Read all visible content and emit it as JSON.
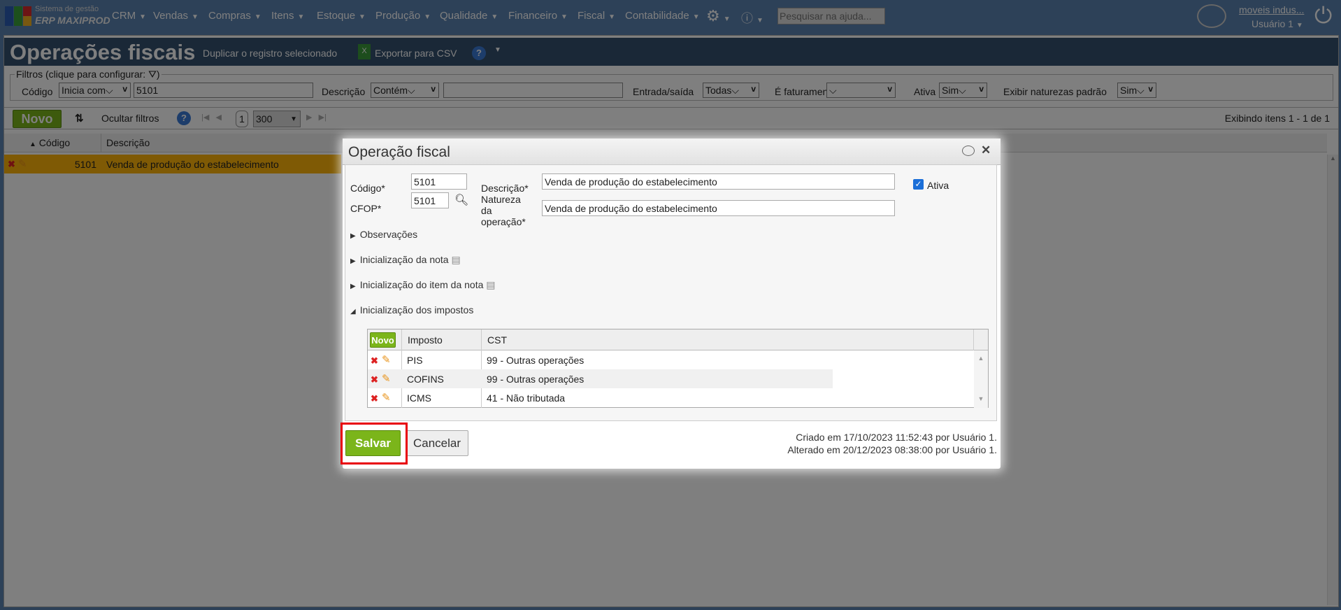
{
  "app": {
    "brand_line1": "Sistema de gestão",
    "brand_line2": "ERP MAXIPROD",
    "menu": [
      "CRM",
      "Vendas",
      "Compras",
      "Itens",
      "Estoque",
      "Produção",
      "Qualidade",
      "Financeiro",
      "Fiscal",
      "Contabilidade"
    ],
    "help_search_placeholder": "Pesquisar na ajuda...",
    "company": "moveis indus...",
    "user": "Usuário 1"
  },
  "page": {
    "title": "Operações fiscais",
    "duplicate": "Duplicar o registro selecionado",
    "export": "Exportar para CSV"
  },
  "filters": {
    "legend": "Filtros (clique para configurar:",
    "legend_end": ")",
    "codigo_label": "Código",
    "codigo_op": "Inicia com",
    "codigo_value": "5101",
    "descricao_label": "Descrição",
    "descricao_op": "Contém",
    "descricao_value": "",
    "entrada_label": "Entrada/saída",
    "entrada_value": "Todas",
    "faturamento_label": "É faturamento?",
    "faturamento_value": "",
    "ativa_label": "Ativa",
    "ativa_value": "Sim",
    "naturezas_label": "Exibir naturezas padrão",
    "naturezas_value": "Sim"
  },
  "toolbar": {
    "novo": "Novo",
    "ocultar": "Ocultar filtros",
    "page": "1",
    "page_size": "300",
    "status": "Exibindo itens 1 - 1 de 1"
  },
  "grid": {
    "headers": [
      "Código",
      "Descrição"
    ],
    "rows": [
      {
        "codigo": "5101",
        "descricao": "Venda de produção do estabelecimento"
      }
    ]
  },
  "dialog": {
    "title": "Operação fiscal",
    "codigo_label": "Código*",
    "codigo": "5101",
    "cfop_label": "CFOP*",
    "cfop": "5101",
    "descricao_label": "Descrição*",
    "descricao": "Venda de produção do estabelecimento",
    "natureza_label": "Natureza da operação*",
    "natureza": "Venda de produção do estabelecimento",
    "ativa_label": "Ativa",
    "ativa_checked": true,
    "sections": [
      "Observações",
      "Inicialização da nota",
      "Inicialização do item da nota",
      "Inicialização dos impostos"
    ],
    "taxes": {
      "novo": "Novo",
      "headers": [
        "Imposto",
        "CST"
      ],
      "rows": [
        {
          "imposto": "PIS",
          "cst": "99 - Outras operações"
        },
        {
          "imposto": "COFINS",
          "cst": "99 - Outras operações"
        },
        {
          "imposto": "ICMS",
          "cst": "41 - Não tributada"
        }
      ]
    },
    "save": "Salvar",
    "cancel": "Cancelar",
    "created": "Criado em 17/10/2023 11:52:43 por Usuário 1.",
    "altered": "Alterado em 20/12/2023 08:38:00 por Usuário 1."
  }
}
